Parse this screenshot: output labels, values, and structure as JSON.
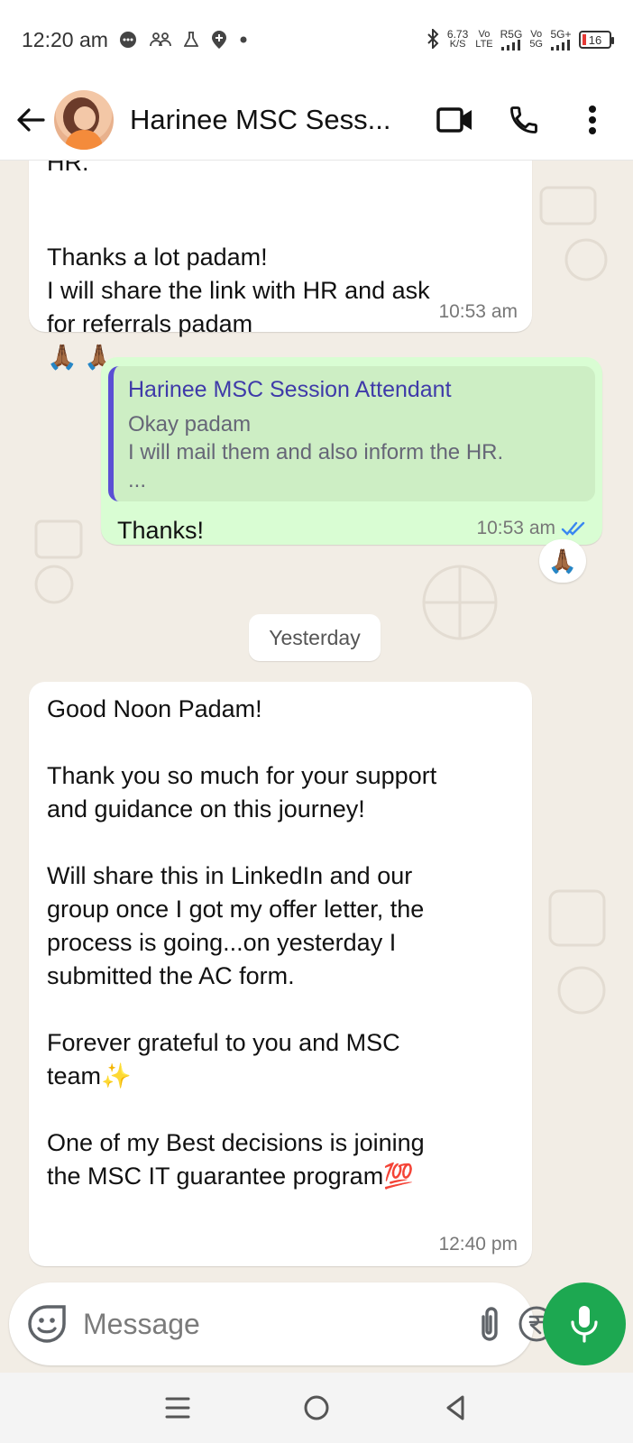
{
  "status_bar": {
    "time": "12:20 am",
    "net_speed_value": "6.73",
    "net_speed_unit": "K/S",
    "sim1_top": "Vo",
    "sim1_bottom": "LTE",
    "sim1_net": "R5G",
    "sim2_top": "Vo",
    "sim2_bottom": "5G",
    "sim2_net": "5G+",
    "battery_level": "16"
  },
  "header": {
    "contact_name": "Harinee MSC Sess..."
  },
  "messages": [
    {
      "id": "m1",
      "partial_top": "HR.",
      "text": "Thanks a lot padam!\nI will share the link with HR and ask\nfor referrals padam",
      "emoji": "🙏🏾 🙏🏾",
      "time": "10:53 am"
    },
    {
      "id": "m2",
      "quote_name": "Harinee MSC Session Attendant",
      "quote_text": "Okay padam\n I will mail them and also inform the HR.\n ...",
      "text": "Thanks!",
      "time": "10:53 am",
      "status": "read",
      "reaction": "🙏🏾"
    },
    {
      "id": "m3",
      "text": "Good Noon Padam!\n\nThank you so much for your support\nand guidance on this journey!\n\nWill share this in LinkedIn and our\ngroup once I got my offer letter, the\nprocess is going...on yesterday I\nsubmitted the AC form.\n\nForever grateful to you and MSC\nteam✨\n\nOne of my Best decisions is joining\nthe MSC IT guarantee program💯",
      "time": "12:40 pm"
    }
  ],
  "date_separator": "Yesterday",
  "composer": {
    "placeholder": "Message"
  },
  "colors": {
    "accent_green": "#1da851",
    "outgoing_bubble": "#d9fdd3",
    "quote_bar": "#5b4fd4",
    "read_tick": "#3a87f1"
  },
  "icons": [
    "back-arrow-icon",
    "video-call-icon",
    "phone-icon",
    "more-vert-icon",
    "emoji-icon",
    "attach-icon",
    "rupee-icon",
    "camera-icon",
    "mic-icon"
  ]
}
